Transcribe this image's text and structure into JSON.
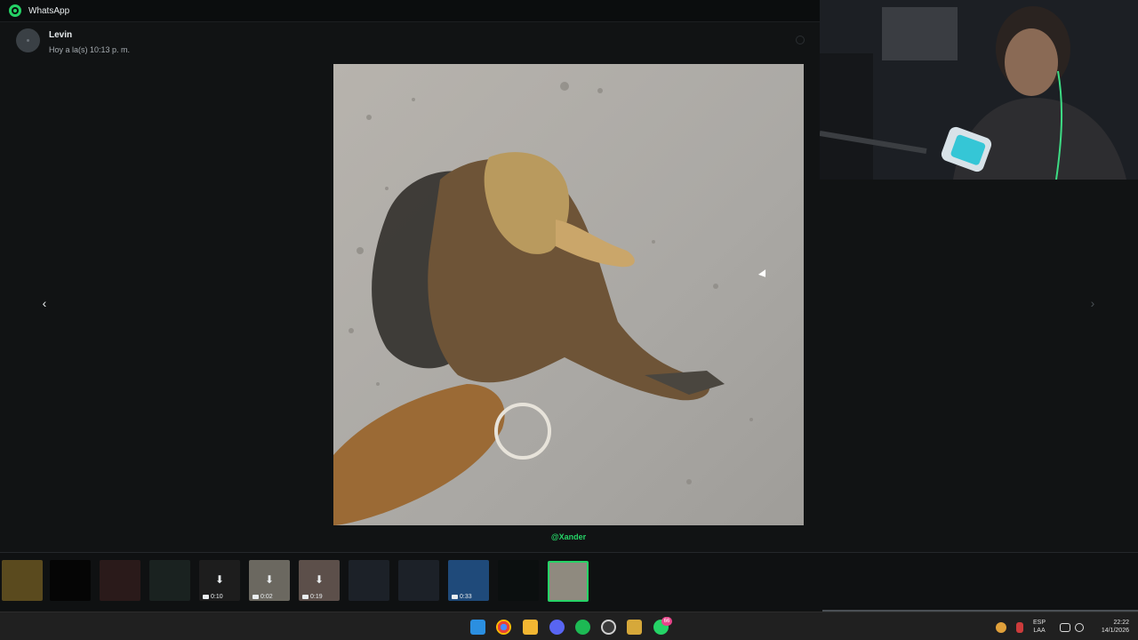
{
  "window": {
    "title": "WhatsApp"
  },
  "message": {
    "sender_name": "Levin",
    "timestamp": "Hoy a la(s) 10:13 p. m.",
    "caption": "@Xander"
  },
  "navigation": {
    "prev_icon": "‹",
    "next_icon": "›"
  },
  "thumbnails": [
    {
      "kind": "image"
    },
    {
      "kind": "image"
    },
    {
      "kind": "image"
    },
    {
      "kind": "image"
    },
    {
      "kind": "video",
      "duration": "0:10",
      "downloadable": true
    },
    {
      "kind": "video",
      "duration": "0:02",
      "downloadable": true
    },
    {
      "kind": "video",
      "duration": "0:19",
      "downloadable": true
    },
    {
      "kind": "image"
    },
    {
      "kind": "image"
    },
    {
      "kind": "video",
      "duration": "0:33"
    },
    {
      "kind": "image"
    },
    {
      "kind": "image",
      "active": true
    }
  ],
  "taskbar": {
    "apps": [
      "windows-start-icon",
      "chrome-icon",
      "file-explorer-icon",
      "discord-icon",
      "spotify-icon",
      "obs-icon",
      "game-icon",
      "whatsapp-icon"
    ],
    "whatsapp_badge": "66",
    "language_top": "ESP",
    "language_bottom": "LAA",
    "clock_time": "22:22",
    "clock_date": "14/1/2026"
  },
  "colors": {
    "accent": "#25d366",
    "background": "#111314",
    "taskbar": "#202020"
  }
}
